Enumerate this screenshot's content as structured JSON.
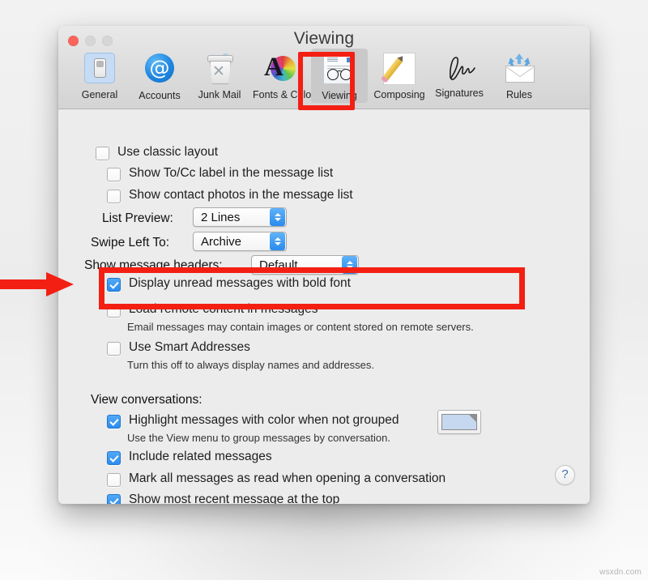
{
  "window": {
    "title": "Viewing",
    "traffic_lights": [
      "close",
      "minimize",
      "zoom"
    ]
  },
  "toolbar": {
    "items": [
      {
        "label": "General",
        "icon": "general-switch-icon",
        "selected": false
      },
      {
        "label": "Accounts",
        "icon": "at-sign-icon",
        "selected": false
      },
      {
        "label": "Junk Mail",
        "icon": "trash-can-icon",
        "selected": false
      },
      {
        "label": "Fonts & Colors",
        "icon": "font-colorwheel-icon",
        "selected": false
      },
      {
        "label": "Viewing",
        "icon": "eyeglasses-icon",
        "selected": true
      },
      {
        "label": "Composing",
        "icon": "pencil-paper-icon",
        "selected": false
      },
      {
        "label": "Signatures",
        "icon": "handwriting-icon",
        "selected": false
      },
      {
        "label": "Rules",
        "icon": "envelope-arrows-icon",
        "selected": false
      }
    ]
  },
  "settings": {
    "use_classic_layout": {
      "label": "Use classic layout",
      "checked": false
    },
    "show_tocc_label": {
      "label": "Show To/Cc label in the message list",
      "checked": false
    },
    "show_contact_photos": {
      "label": "Show contact photos in the message list",
      "checked": false
    },
    "list_preview": {
      "label": "List Preview:",
      "value": "2 Lines"
    },
    "swipe_left_to": {
      "label": "Swipe Left To:",
      "value": "Archive"
    },
    "show_message_headers": {
      "label": "Show message headers:",
      "value": "Default"
    },
    "display_unread_bold": {
      "label": "Display unread messages with bold font",
      "checked": true
    },
    "load_remote_content": {
      "label": "Load remote content in messages",
      "checked": false,
      "note": "Email messages may contain images or content stored on remote servers."
    },
    "use_smart_addresses": {
      "label": "Use Smart Addresses",
      "checked": false,
      "note": "Turn this off to always display names and addresses."
    }
  },
  "conversations": {
    "heading": "View conversations:",
    "highlight_with_color": {
      "label": "Highlight messages with color when not grouped",
      "checked": true,
      "note": "Use the View menu to group messages by conversation.",
      "swatch_color": "#c6d8f0"
    },
    "include_related": {
      "label": "Include related messages",
      "checked": true
    },
    "mark_all_read": {
      "label": "Mark all messages as read when opening a conversation",
      "checked": false
    },
    "show_most_recent": {
      "label": "Show most recent message at the top",
      "checked": true
    }
  },
  "help": {
    "label": "?"
  },
  "annotations": {
    "accent_color": "#f41f13",
    "highlight_tab": "Viewing",
    "highlight_setting": "Load remote content in messages"
  },
  "watermark": {
    "text": "wsxdn.com"
  }
}
